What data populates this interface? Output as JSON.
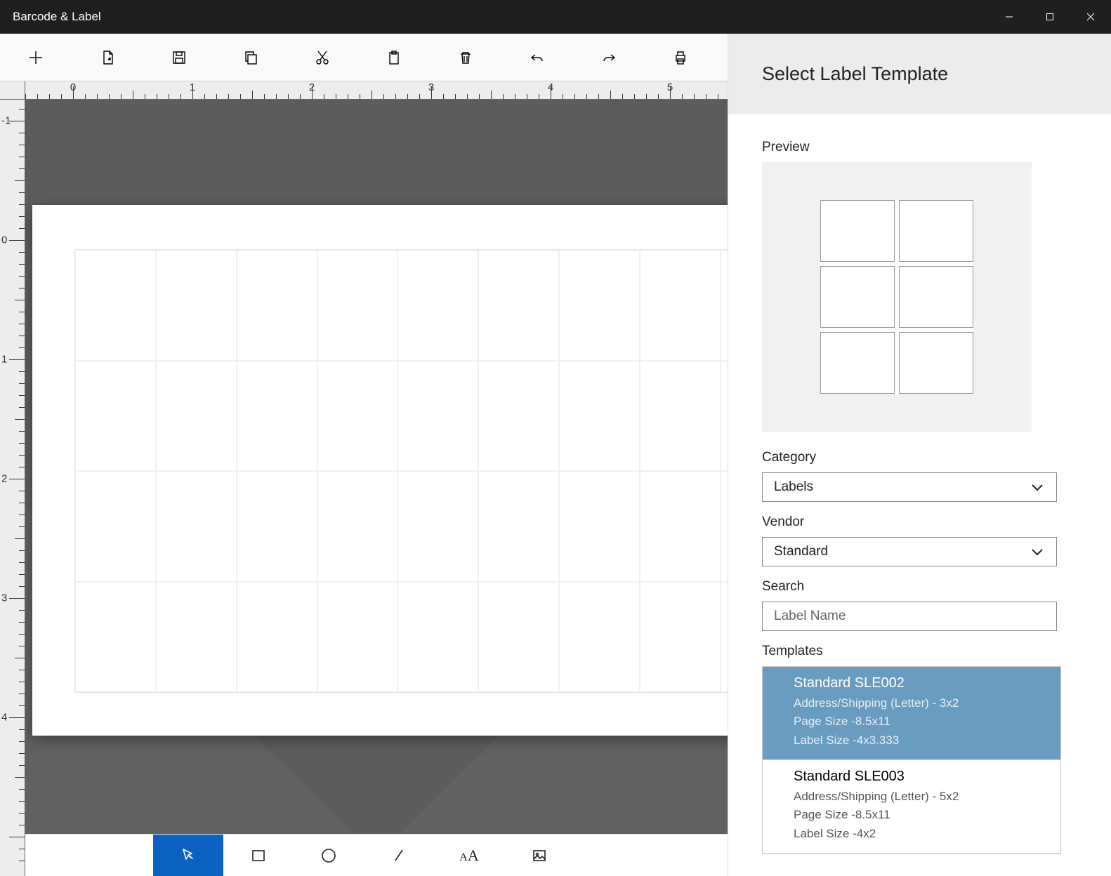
{
  "window": {
    "title": "Barcode & Label"
  },
  "toolbar": {
    "items": [
      {
        "name": "new",
        "icon": "plus-icon"
      },
      {
        "name": "open",
        "icon": "open-icon"
      },
      {
        "name": "save",
        "icon": "save-icon"
      },
      {
        "name": "copy",
        "icon": "copy-icon"
      },
      {
        "name": "cut",
        "icon": "cut-icon"
      },
      {
        "name": "paste",
        "icon": "paste-icon"
      },
      {
        "name": "delete",
        "icon": "delete-icon"
      },
      {
        "name": "undo",
        "icon": "undo-icon"
      },
      {
        "name": "redo",
        "icon": "redo-icon"
      },
      {
        "name": "print",
        "icon": "print-icon"
      }
    ]
  },
  "ruler": {
    "hlabels": [
      "0",
      "1",
      "2",
      "3",
      "4",
      "5"
    ],
    "vlabels": [
      "-1",
      "0",
      "1",
      "2",
      "3",
      "4"
    ]
  },
  "bottombar": {
    "items": [
      {
        "name": "pointer-tool",
        "active": true
      },
      {
        "name": "rectangle-tool",
        "active": false
      },
      {
        "name": "ellipse-tool",
        "active": false
      },
      {
        "name": "line-tool",
        "active": false
      },
      {
        "name": "text-tool",
        "active": false
      },
      {
        "name": "image-tool",
        "active": false
      }
    ]
  },
  "panel": {
    "title": "Select Label Template",
    "preview_label": "Preview",
    "category_label": "Category",
    "category_value": "Labels",
    "vendor_label": "Vendor",
    "vendor_value": "Standard",
    "search_label": "Search",
    "search_placeholder": "Label Name",
    "templates_label": "Templates",
    "templates": [
      {
        "name": "Standard SLE002",
        "desc": "Address/Shipping (Letter) - 3x2",
        "page": "Page Size -8.5x11",
        "label": "Label Size -4x3.333",
        "selected": true
      },
      {
        "name": "Standard SLE003",
        "desc": "Address/Shipping (Letter) - 5x2",
        "page": "Page Size -8.5x11",
        "label": "Label Size -4x2",
        "selected": false
      }
    ]
  }
}
